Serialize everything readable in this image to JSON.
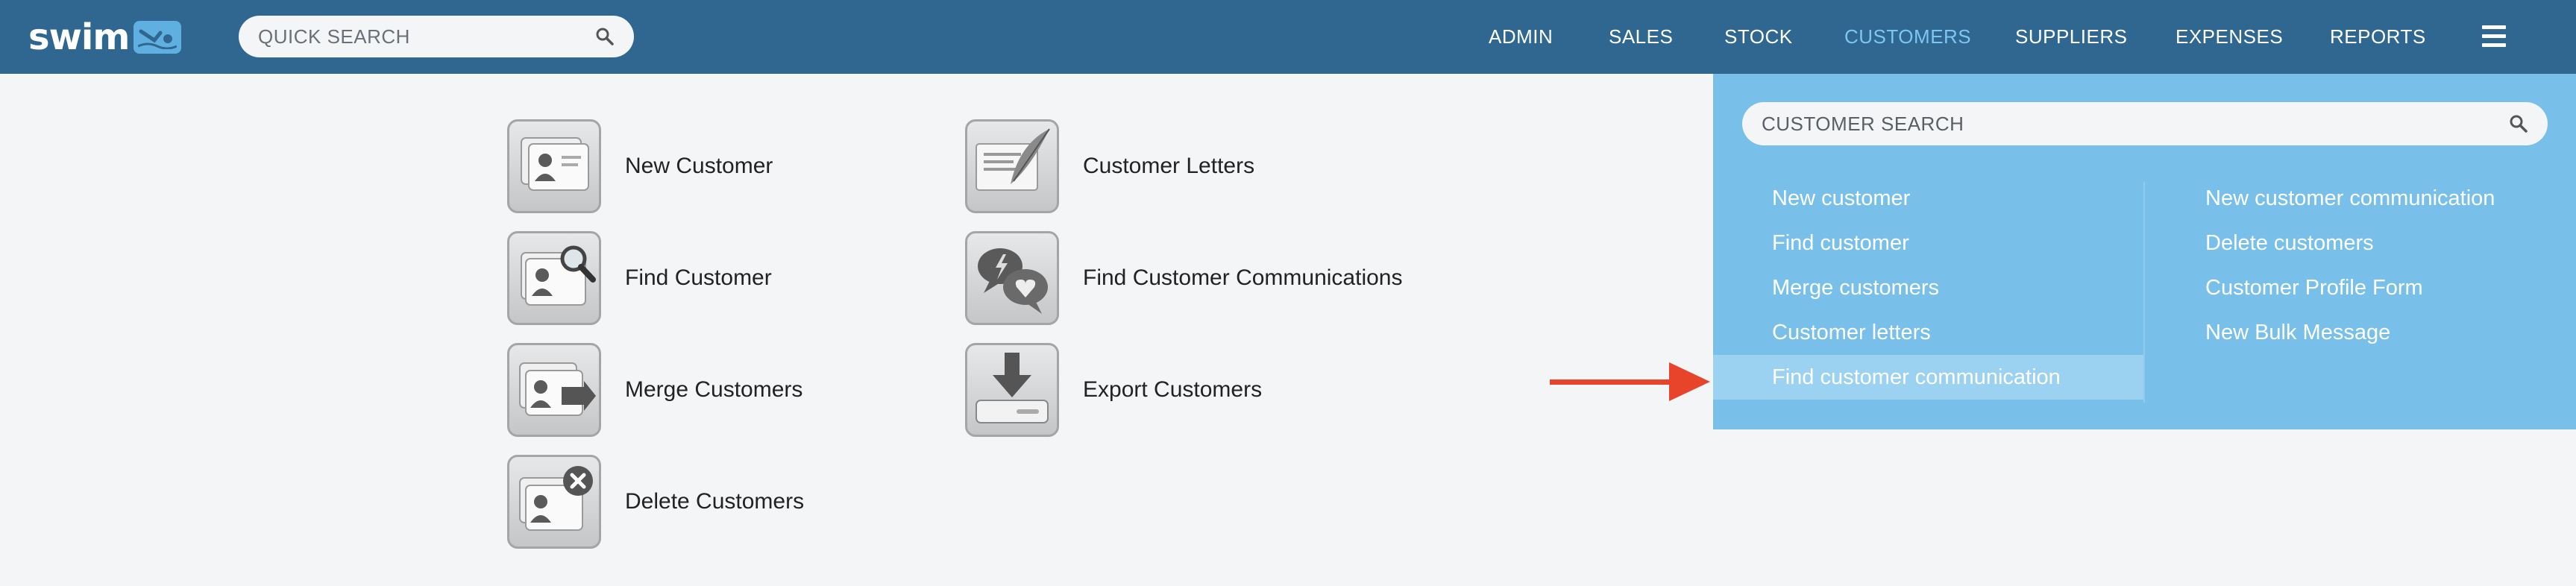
{
  "header": {
    "logo_text": "swim",
    "search_placeholder": "QUICK SEARCH",
    "nav": [
      {
        "label": "ADMIN"
      },
      {
        "label": "SALES"
      },
      {
        "label": "STOCK"
      },
      {
        "label": "CUSTOMERS",
        "active": true
      },
      {
        "label": "SUPPLIERS"
      },
      {
        "label": "EXPENSES"
      },
      {
        "label": "REPORTS"
      }
    ]
  },
  "tiles": [
    {
      "label": "New Customer",
      "icon": "new-customer-card-icon"
    },
    {
      "label": "Find Customer",
      "icon": "find-customer-magnifier-icon"
    },
    {
      "label": "Merge Customers",
      "icon": "merge-customers-icon"
    },
    {
      "label": "Delete Customers",
      "icon": "delete-customers-x-icon"
    },
    {
      "label": "Customer Letters",
      "icon": "letter-quill-icon"
    },
    {
      "label": "Find Customer Communications",
      "icon": "speech-bubbles-icon"
    },
    {
      "label": "Export Customers",
      "icon": "download-tray-icon"
    }
  ],
  "dropdown": {
    "search_placeholder": "CUSTOMER SEARCH",
    "left_links": [
      {
        "label": "New customer"
      },
      {
        "label": "Find customer"
      },
      {
        "label": "Merge customers"
      },
      {
        "label": "Customer letters"
      },
      {
        "label": "Find customer communication",
        "highlighted": true
      }
    ],
    "right_links": [
      {
        "label": "New customer communication"
      },
      {
        "label": "Delete customers"
      },
      {
        "label": "Customer Profile Form"
      },
      {
        "label": "New Bulk Message"
      }
    ]
  },
  "colors": {
    "topbar": "#2f6790",
    "active_nav": "#7ec6f0",
    "dropdown_bg": "#78c0ea",
    "highlight_row": "#9bd1f1",
    "annotation_arrow": "#e8432b"
  }
}
